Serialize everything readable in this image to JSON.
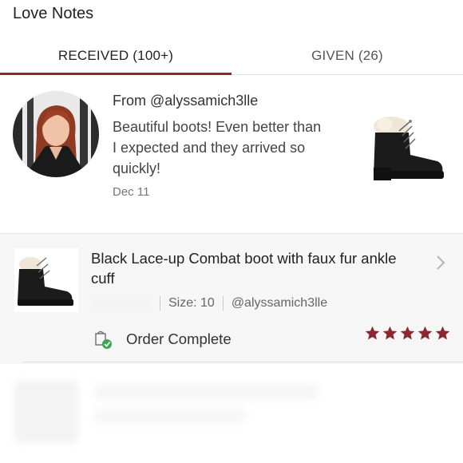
{
  "header": {
    "title": "Love Notes"
  },
  "tabs": [
    {
      "label": "RECEIVED (100+)",
      "active": true
    },
    {
      "label": "GIVEN (26)",
      "active": false
    }
  ],
  "note": {
    "from": "From @alyssamich3lle",
    "message": "Beautiful boots! Even better than I expected and they arrived so quickly!",
    "date": "Dec 11"
  },
  "order": {
    "title": "Black Lace-up Combat boot with faux fur ankle cuff",
    "size": "Size: 10",
    "buyer": "@alyssamich3lle",
    "status": "Order Complete",
    "rating": 5
  },
  "colors": {
    "accent": "#8c2730",
    "status_green": "#3aa655",
    "text": "#222222"
  },
  "icons": {
    "chevron": "chevron-right-icon",
    "status": "order-complete-icon",
    "star": "star-icon"
  }
}
